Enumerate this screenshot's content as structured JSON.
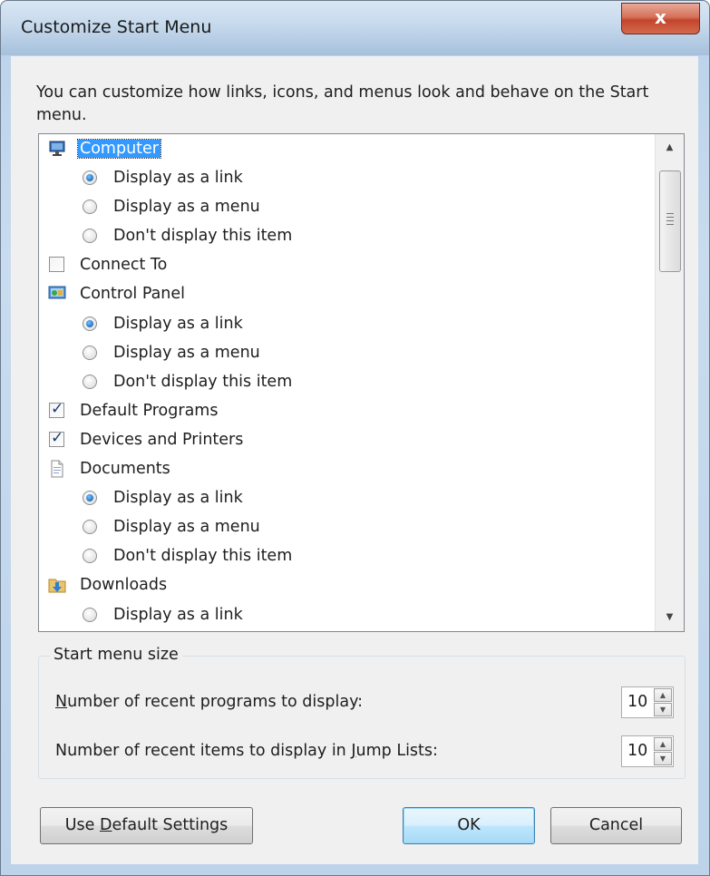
{
  "window": {
    "title": "Customize Start Menu",
    "close_label": "x"
  },
  "description": "You can customize how links, icons, and menus look and behave on the Start menu.",
  "list": {
    "items": [
      {
        "kind": "node",
        "icon": "computer-icon",
        "label": "Computer",
        "selected": true
      },
      {
        "kind": "radio",
        "label": "Display as a link",
        "checked": true
      },
      {
        "kind": "radio",
        "label": "Display as a menu",
        "checked": false
      },
      {
        "kind": "radio",
        "label": "Don't display this item",
        "checked": false
      },
      {
        "kind": "check",
        "label": "Connect To",
        "checked": false
      },
      {
        "kind": "node",
        "icon": "control-panel-icon",
        "label": "Control Panel"
      },
      {
        "kind": "radio",
        "label": "Display as a link",
        "checked": true
      },
      {
        "kind": "radio",
        "label": "Display as a menu",
        "checked": false
      },
      {
        "kind": "radio",
        "label": "Don't display this item",
        "checked": false
      },
      {
        "kind": "check",
        "label": "Default Programs",
        "checked": true
      },
      {
        "kind": "check",
        "label": "Devices and Printers",
        "checked": true
      },
      {
        "kind": "node",
        "icon": "documents-icon",
        "label": "Documents"
      },
      {
        "kind": "radio",
        "label": "Display as a link",
        "checked": true
      },
      {
        "kind": "radio",
        "label": "Display as a menu",
        "checked": false
      },
      {
        "kind": "radio",
        "label": "Don't display this item",
        "checked": false
      },
      {
        "kind": "node",
        "icon": "downloads-icon",
        "label": "Downloads"
      },
      {
        "kind": "radio",
        "label": "Display as a link",
        "checked": false
      }
    ]
  },
  "start_menu_size": {
    "group_label": "Start menu size",
    "recent_programs": {
      "label_pre": "",
      "label_u": "N",
      "label_post": "umber of recent programs to display:",
      "value": "10"
    },
    "recent_items": {
      "label_pre": "Number of recent items to display in ",
      "label_u": "J",
      "label_post": "ump Lists:",
      "value": "10"
    }
  },
  "buttons": {
    "default_settings": {
      "pre": "Use ",
      "u": "D",
      "post": "efault Settings"
    },
    "ok": "OK",
    "cancel": "Cancel"
  },
  "colors": {
    "selection": "#3399ff",
    "dialog_bg": "#f0f0f0",
    "close_red": "#c4452b"
  }
}
